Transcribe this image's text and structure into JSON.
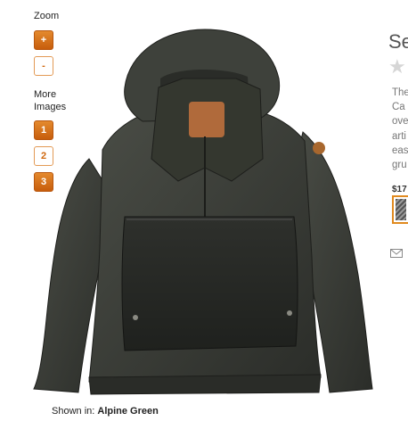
{
  "zoom": {
    "label": "Zoom",
    "plus_label": "+",
    "minus_label": "-"
  },
  "more_images": {
    "label_line1": "More",
    "label_line2": "Images",
    "items": [
      "1",
      "2",
      "3"
    ]
  },
  "product": {
    "title_partial": "Se",
    "description_lines": [
      "The",
      "Ca",
      "ove",
      "arti",
      "eas",
      "gru"
    ],
    "price_partial": "$17",
    "shown_in_label": "Shown in:",
    "shown_in_color": "Alpine Green"
  },
  "colors": {
    "accent": "#d0680f",
    "swatch_border": "#e08a1f"
  },
  "icons": {
    "rating": "star-icon",
    "email": "envelope-icon",
    "image": "jacket-product-photo"
  }
}
